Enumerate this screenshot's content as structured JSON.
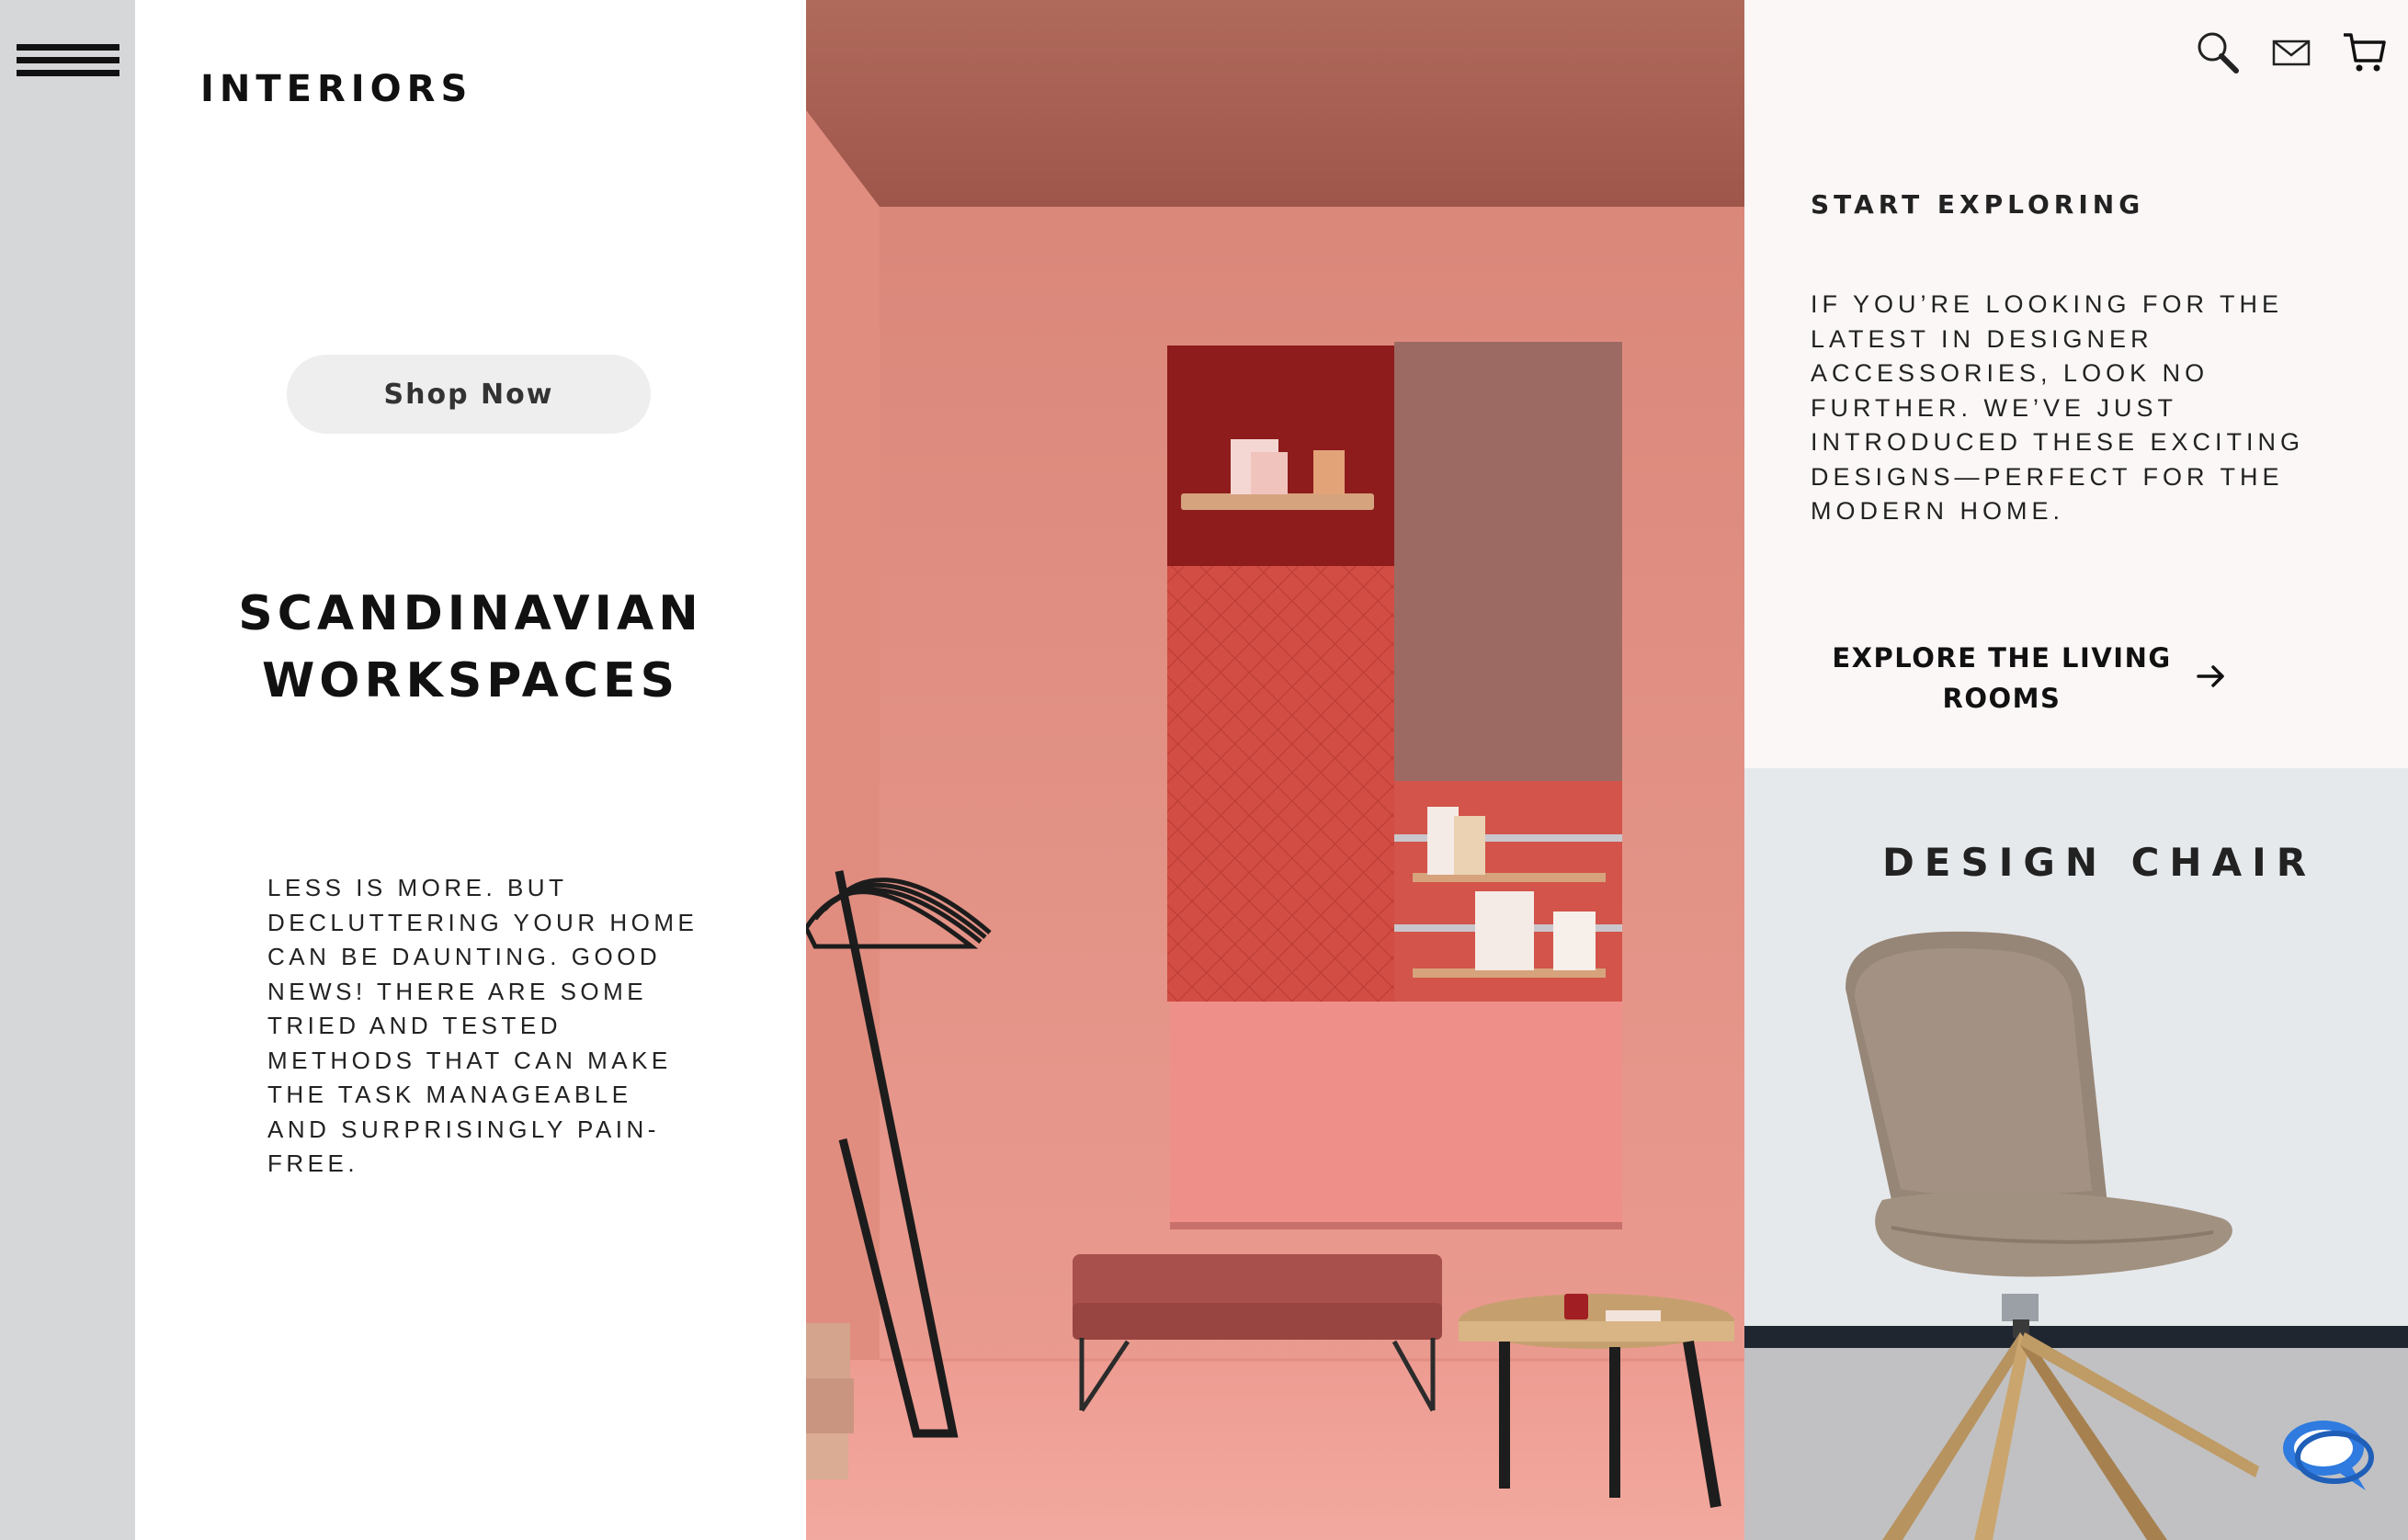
{
  "brand": "INTERIORS",
  "hero_left": {
    "cta_label": "Shop Now",
    "headline_line1": "SCANDINAVIAN",
    "headline_line2": "WORKSPACES",
    "body": "LESS IS MORE. BUT DECLUTTERING YOUR HOME CAN BE DAUNTING. GOOD NEWS! THERE ARE SOME TRIED AND TESTED METHODS THAT CAN MAKE THE TASK MANAGEABLE AND SURPRISINGLY PAIN-FREE."
  },
  "header_icons": [
    "search-icon",
    "mail-icon",
    "cart-icon"
  ],
  "explore": {
    "title": "START EXPLORING",
    "body": "IF YOU’RE LOOKING FOR THE LATEST IN DESIGNER ACCESSORIES, LOOK NO FURTHER. WE’VE JUST INTRODUCED THESE EXCITING DESIGNS—PERFECT FOR THE MODERN HOME.",
    "cta_line1": "EXPLORE THE LIVING",
    "cta_line2": "ROOMS"
  },
  "feature": {
    "title": "DESIGN CHAIR"
  },
  "colors": {
    "rail": "#d6d7d9",
    "hero_wall": "#e8958a",
    "panel_bg": "#fbf7f6",
    "chair_bg": "#e6e9ec",
    "chat_accent": "#2f7be0"
  }
}
